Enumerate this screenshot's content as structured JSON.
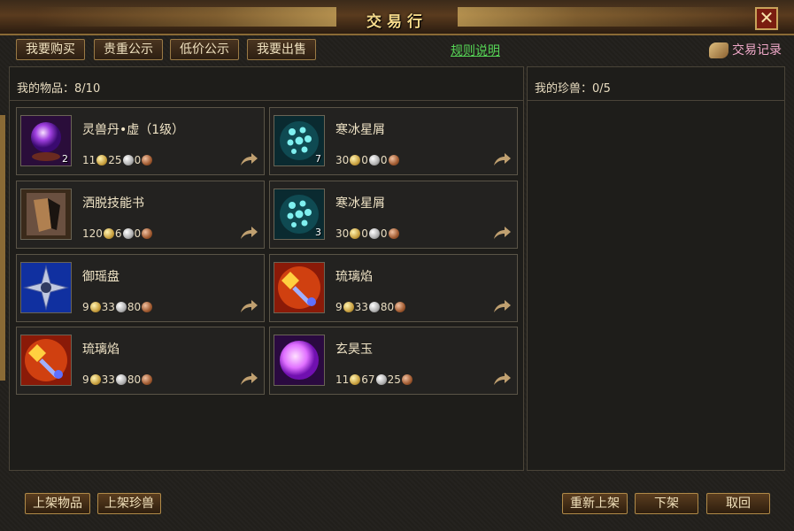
{
  "window": {
    "title": "交易行",
    "close_label": "✕"
  },
  "tabs": [
    {
      "label": "我要购买"
    },
    {
      "label": "贵重公示"
    },
    {
      "label": "低价公示"
    },
    {
      "label": "我要出售"
    }
  ],
  "rules_link": "规则说明",
  "record_link": "交易记录",
  "left_panel": {
    "label": "我的物品：",
    "count": "8/10",
    "items": [
      {
        "name": "灵兽丹•虚（1级）",
        "count": "2",
        "gold": "11",
        "silver": "25",
        "copper": "0",
        "icon": "purple-orb-icon"
      },
      {
        "name": "寒冰星屑",
        "count": "7",
        "gold": "30",
        "silver": "0",
        "copper": "0",
        "icon": "ice-shard-icon"
      },
      {
        "name": "洒脱技能书",
        "count": "",
        "gold": "120",
        "silver": "6",
        "copper": "0",
        "icon": "skill-book-icon"
      },
      {
        "name": "寒冰星屑",
        "count": "3",
        "gold": "30",
        "silver": "0",
        "copper": "0",
        "icon": "ice-shard-icon"
      },
      {
        "name": "御瑶盘",
        "count": "",
        "gold": "9",
        "silver": "33",
        "copper": "80",
        "icon": "shuriken-icon"
      },
      {
        "name": "琉璃焰",
        "count": "",
        "gold": "9",
        "silver": "33",
        "copper": "80",
        "icon": "fire-crystal-icon"
      },
      {
        "name": "琉璃焰",
        "count": "",
        "gold": "9",
        "silver": "33",
        "copper": "80",
        "icon": "fire-crystal-icon"
      },
      {
        "name": "玄昊玉",
        "count": "",
        "gold": "11",
        "silver": "67",
        "copper": "25",
        "icon": "pink-jade-icon"
      }
    ]
  },
  "right_panel": {
    "label": "我的珍兽：",
    "count": "0/5"
  },
  "buttons": {
    "list_item": "上架物品",
    "list_pet": "上架珍兽",
    "relist": "重新上架",
    "delist": "下架",
    "withdraw": "取回"
  },
  "colors": {
    "accent": "#c8a25a",
    "link_green": "#56d656",
    "record_pink": "#f0a8c8"
  }
}
